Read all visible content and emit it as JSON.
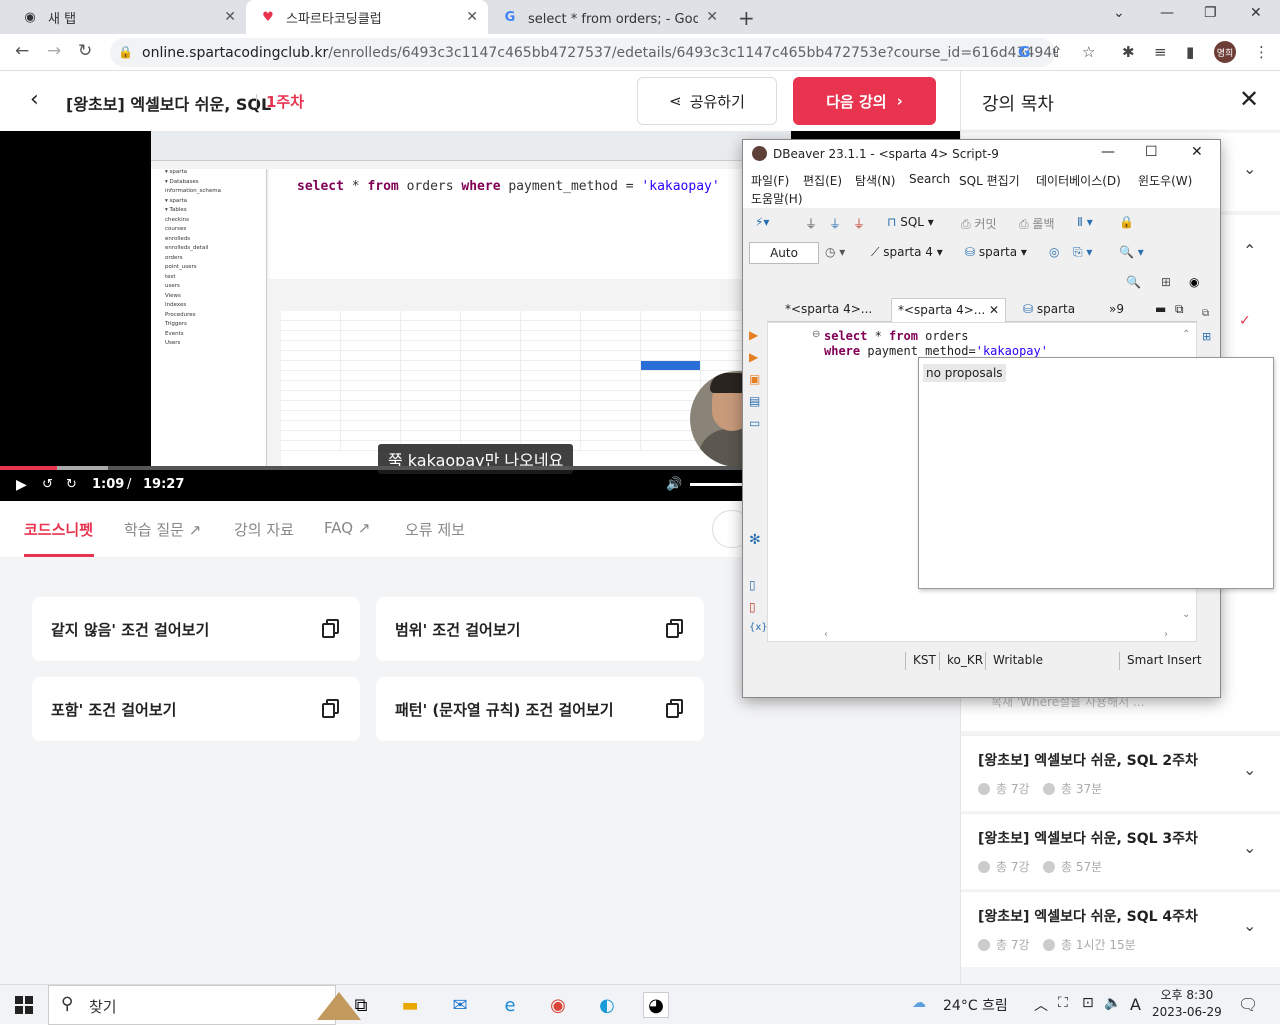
{
  "browser": {
    "tabs": [
      {
        "title": "새 탭",
        "icon": "chrome-icon"
      },
      {
        "title": "스파르타코딩클럽",
        "icon": "sparta-icon"
      },
      {
        "title": "select * from orders; - Google 검",
        "icon": "google-icon"
      }
    ],
    "url_host": "online.spartacodingclub.kr",
    "url_path": "/enrolleds/6493c3c1147c465bb4727537/edetails/6493c3c1147c465bb472753e?course_id=616d4349460cf1cf...",
    "profile_label": "명희"
  },
  "header": {
    "course_title": "[왕초보] 엑셀보다 쉬운, SQL",
    "week": "1주차",
    "share_label": "공유하기",
    "next_label": "다음 강의"
  },
  "video": {
    "current_time": "1:09",
    "separator": "/",
    "duration": "19:27",
    "subtitle": "쭉 kakaopay만 나오네요",
    "played_fraction": 0.059,
    "buffered_fraction": 0.112,
    "inner_sql": "select * from orders where payment_method = 'kakaopay'"
  },
  "lecture_tabs": [
    {
      "label": "코드스니펫",
      "external": false
    },
    {
      "label": "학습 질문",
      "external": true
    },
    {
      "label": "강의 자료",
      "external": false
    },
    {
      "label": "FAQ",
      "external": true
    },
    {
      "label": "오류 제보",
      "external": false
    }
  ],
  "snippets": [
    {
      "label": "같지 않음' 조건 걸어보기"
    },
    {
      "label": "범위' 조건 걸어보기"
    },
    {
      "label": "포함' 조건 걸어보기"
    },
    {
      "label": "패턴' (문자열 규칙) 조건 걸어보기"
    }
  ],
  "toc": {
    "title": "강의 목차",
    "faded_text": "목새 'Where절을 사용해서 ...",
    "weeks": [
      {
        "title": "[왕초보] 엑셀보다 쉬운, SQL 2주차",
        "count": "총 7강",
        "time": "총 37분"
      },
      {
        "title": "[왕초보] 엑셀보다 쉬운, SQL 3주차",
        "count": "총 7강",
        "time": "총 57분"
      },
      {
        "title": "[왕초보] 엑셀보다 쉬운, SQL 4주차",
        "count": "총 7강",
        "time": "총 1시간 15분"
      }
    ]
  },
  "dbeaver": {
    "title": "DBeaver 23.1.1 - <sparta 4> Script-9",
    "menu": [
      "파일(F)",
      "편집(E)",
      "탐색(N)",
      "Search",
      "SQL 편집기",
      "데이터베이스(D)",
      "윈도우(W)",
      "도움말(H)"
    ],
    "toolbar": {
      "sql": "SQL",
      "commit": "커밋",
      "rollback": "롤백",
      "auto": "Auto",
      "connection": "sparta 4",
      "schema": "sparta"
    },
    "editor_tabs": [
      "*<sparta 4>...",
      "*<sparta 4>...",
      "sparta",
      "»9"
    ],
    "code_line1": "select * from orders",
    "code_line2_kw": "where",
    "code_line2_rest": " payment_method=",
    "code_line2_str": "'kakaopay'",
    "proposals": "no proposals",
    "status": [
      "KST",
      "ko_KR",
      "Writable",
      "Smart Insert"
    ]
  },
  "taskbar": {
    "search_placeholder": "찾기",
    "weather": "24°C 흐림",
    "ime": "A",
    "time": "오후 8:30",
    "date": "2023-06-29"
  }
}
